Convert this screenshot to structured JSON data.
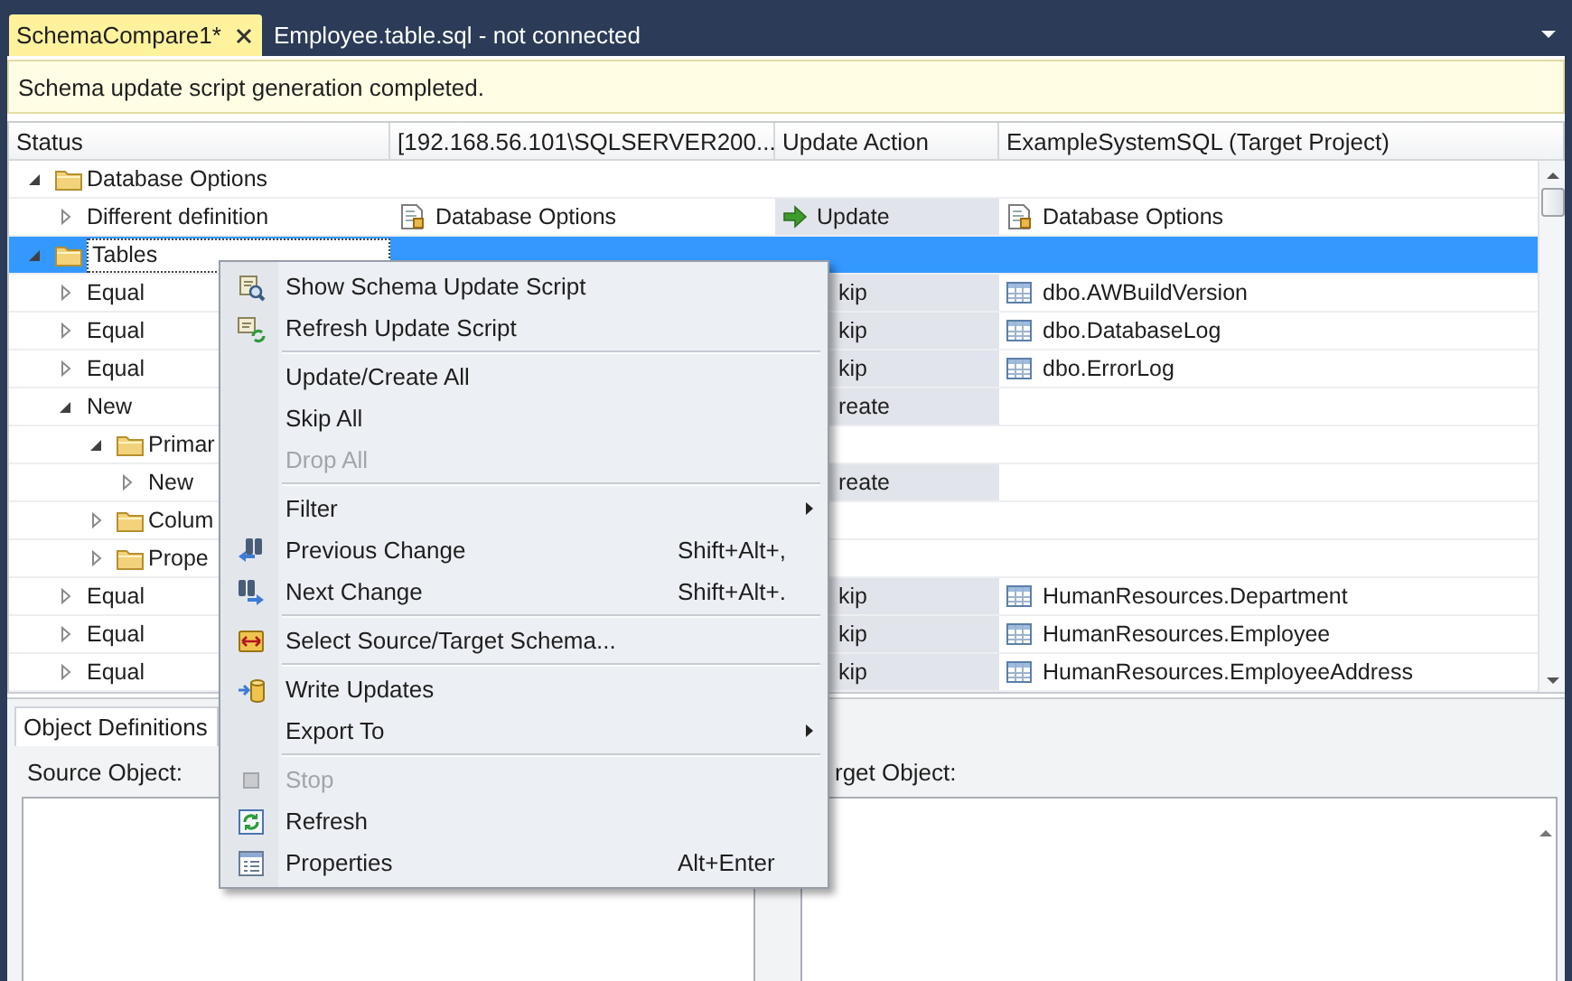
{
  "tabs": [
    {
      "label": "SchemaCompare1*",
      "selected": true
    },
    {
      "label": "Employee.table.sql - not connected",
      "selected": false
    }
  ],
  "info_bar": {
    "message": "Schema update script generation completed."
  },
  "grid": {
    "columns": [
      "Status",
      "[192.168.56.101\\SQLSERVER200...",
      "Update Action",
      "ExampleSystemSQL (Target Project)"
    ],
    "rows": [
      {
        "label": "Database Options",
        "kind": "folder",
        "expanded": true,
        "selected": false,
        "children": [
          {
            "label": "Different definition",
            "kind": "item",
            "expanded": false,
            "selected": false,
            "source": {
              "kind": "options",
              "text": "Database Options"
            },
            "action": {
              "kind": "update",
              "text": "Update"
            },
            "target": {
              "kind": "options",
              "text": "Database Options"
            }
          }
        ]
      },
      {
        "label": "Tables",
        "kind": "folder",
        "expanded": true,
        "selected": true,
        "children": [
          {
            "label": "Equal",
            "kind": "item",
            "expanded": false,
            "selected": false,
            "action": {
              "kind": "skip",
              "text": "kip"
            },
            "target": {
              "kind": "table",
              "text": "dbo.AWBuildVersion"
            }
          },
          {
            "label": "Equal",
            "kind": "item",
            "expanded": false,
            "selected": false,
            "action": {
              "kind": "skip",
              "text": "kip"
            },
            "target": {
              "kind": "table",
              "text": "dbo.DatabaseLog"
            }
          },
          {
            "label": "Equal",
            "kind": "item",
            "expanded": false,
            "selected": false,
            "action": {
              "kind": "skip",
              "text": "kip"
            },
            "target": {
              "kind": "table",
              "text": "dbo.ErrorLog"
            }
          },
          {
            "label": "New",
            "kind": "item",
            "expanded": true,
            "selected": false,
            "action": {
              "kind": "create",
              "text": "reate"
            },
            "children": [
              {
                "label": "Primar",
                "kind": "folder",
                "expanded": true,
                "selected": false,
                "children": [
                  {
                    "label": "New",
                    "kind": "item",
                    "expanded": false,
                    "selected": false,
                    "action": {
                      "kind": "create",
                      "text": "reate"
                    }
                  }
                ]
              },
              {
                "label": "Colum",
                "kind": "folder",
                "expanded": false,
                "selected": false
              },
              {
                "label": "Prope",
                "kind": "folder",
                "expanded": false,
                "selected": false
              }
            ]
          },
          {
            "label": "Equal",
            "kind": "item",
            "expanded": false,
            "selected": false,
            "action": {
              "kind": "skip",
              "text": "kip"
            },
            "target": {
              "kind": "table",
              "text": "HumanResources.Department"
            }
          },
          {
            "label": "Equal",
            "kind": "item",
            "expanded": false,
            "selected": false,
            "action": {
              "kind": "skip",
              "text": "kip"
            },
            "target": {
              "kind": "table",
              "text": "HumanResources.Employee"
            }
          },
          {
            "label": "Equal",
            "kind": "item",
            "expanded": false,
            "selected": false,
            "action": {
              "kind": "skip",
              "text": "kip"
            },
            "target": {
              "kind": "table",
              "text": "HumanResources.EmployeeAddress"
            }
          }
        ]
      }
    ]
  },
  "context_menu": {
    "groups": [
      [
        {
          "label": "Show Schema Update Script",
          "kind": "show-script",
          "disabled": false,
          "submenu": false
        },
        {
          "label": "Refresh Update Script",
          "kind": "refresh-script",
          "disabled": false,
          "submenu": false
        }
      ],
      [
        {
          "label": "Update/Create All",
          "kind": "plain",
          "disabled": false,
          "submenu": false
        },
        {
          "label": "Skip All",
          "kind": "plain",
          "disabled": false,
          "submenu": false
        },
        {
          "label": "Drop All",
          "kind": "plain",
          "disabled": true,
          "submenu": false
        }
      ],
      [
        {
          "label": "Filter",
          "kind": "plain",
          "disabled": false,
          "submenu": true
        },
        {
          "label": "Previous Change",
          "kind": "previous",
          "disabled": false,
          "submenu": false,
          "shortcut": "Shift+Alt+,"
        },
        {
          "label": "Next Change",
          "kind": "next",
          "disabled": false,
          "submenu": false,
          "shortcut": "Shift+Alt+."
        }
      ],
      [
        {
          "label": "Select Source/Target Schema...",
          "kind": "select-schema",
          "disabled": false,
          "submenu": false
        }
      ],
      [
        {
          "label": "Write Updates",
          "kind": "write",
          "disabled": false,
          "submenu": false
        },
        {
          "label": "Export To",
          "kind": "plain",
          "disabled": false,
          "submenu": true
        }
      ],
      [
        {
          "label": "Stop",
          "kind": "stop",
          "disabled": true,
          "submenu": false
        },
        {
          "label": "Refresh",
          "kind": "refresh",
          "disabled": false,
          "submenu": false
        },
        {
          "label": "Properties",
          "kind": "properties",
          "disabled": false,
          "submenu": false,
          "shortcut": "Alt+Enter"
        }
      ]
    ]
  },
  "definitions_panel": {
    "tabs": [
      {
        "label": "Object Definitions",
        "selected": true
      }
    ],
    "source_label": "Source Object:",
    "target_label": "rget Object:"
  }
}
